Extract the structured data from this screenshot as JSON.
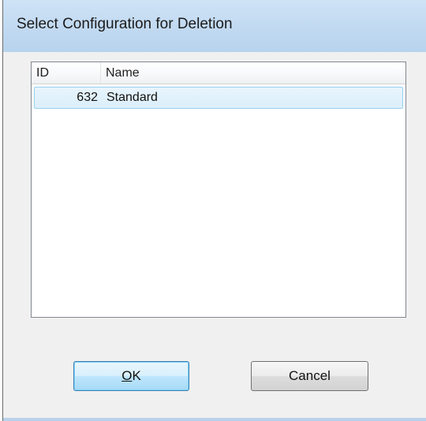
{
  "window": {
    "title": "Select Configuration for Deletion"
  },
  "list": {
    "columns": [
      {
        "label": "ID"
      },
      {
        "label": "Name"
      }
    ],
    "rows": [
      {
        "id": "632",
        "name": "Standard",
        "selected": true
      }
    ]
  },
  "buttons": {
    "ok": {
      "accel": "O",
      "rest": "K"
    },
    "cancel": {
      "label": "Cancel"
    }
  },
  "colors": {
    "titlebar": "#c3dbf2",
    "selection_border": "#99d1ef",
    "selection_fill": "#e1f1fb",
    "default_button_border": "#3c7fb1"
  }
}
